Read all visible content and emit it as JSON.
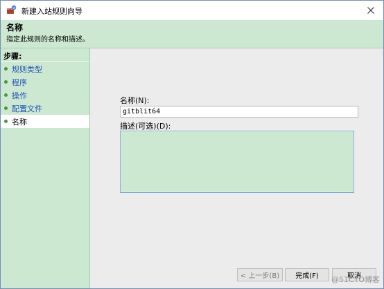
{
  "window": {
    "title": "新建入站规则向导",
    "app_icon": "firewall-shield-icon",
    "close_icon": "close-icon"
  },
  "header": {
    "title": "名称",
    "description": "指定此规则的名称和描述。"
  },
  "sidebar": {
    "title": "步骤:",
    "steps": [
      {
        "label": "规则类型",
        "state": "done"
      },
      {
        "label": "程序",
        "state": "done"
      },
      {
        "label": "操作",
        "state": "done"
      },
      {
        "label": "配置文件",
        "state": "done"
      },
      {
        "label": "名称",
        "state": "current"
      }
    ]
  },
  "form": {
    "name_label": "名称(N):",
    "name_value": "gitblit64",
    "desc_label": "描述(可选)(D):",
    "desc_value": ""
  },
  "buttons": {
    "back": "< 上一步(B)",
    "finish": "完成(F)",
    "cancel": "取消"
  },
  "watermark": "@51CTO博客",
  "colors": {
    "panel_green": "#cde8d1",
    "link_blue": "#1a52b8",
    "step_dot": "#3f9b3a"
  }
}
